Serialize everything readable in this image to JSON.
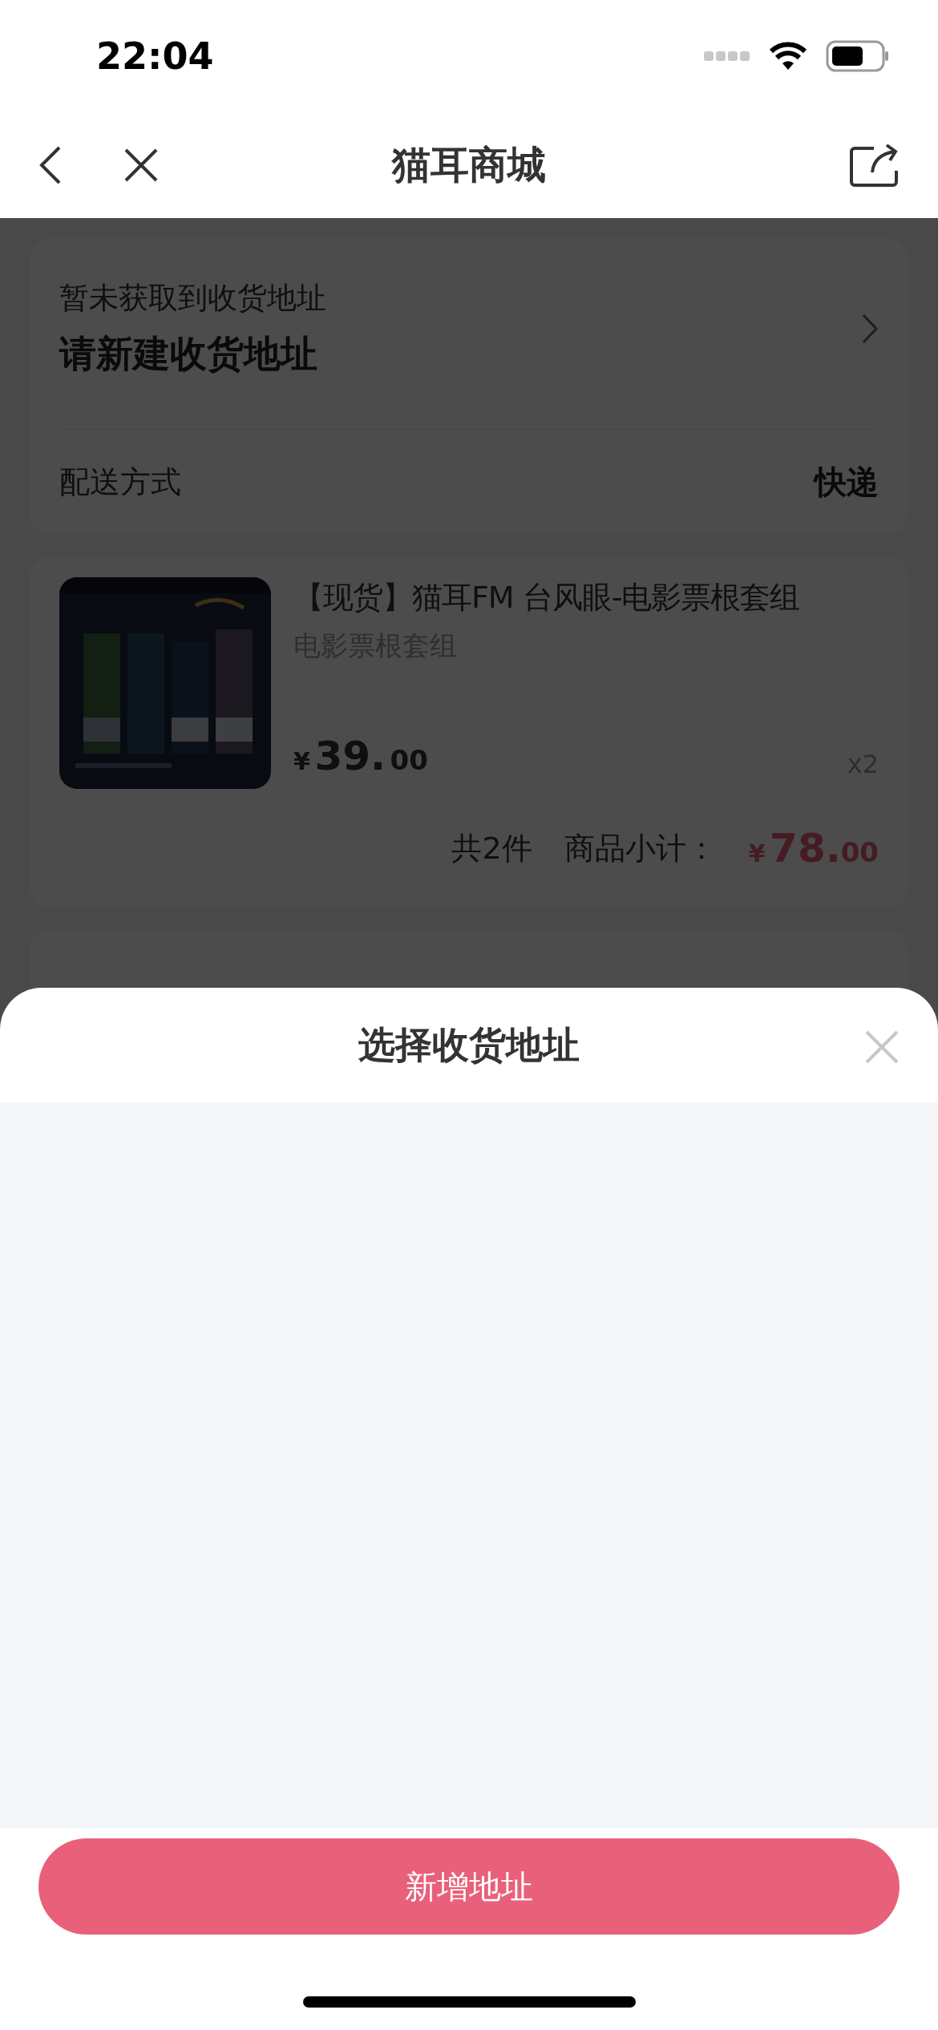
{
  "status_bar": {
    "time": "22:04"
  },
  "nav": {
    "title": "猫耳商城"
  },
  "address": {
    "hint": "暂未获取到收货地址",
    "prompt": "请新建收货地址"
  },
  "delivery": {
    "label": "配送方式",
    "value": "快递"
  },
  "order_item": {
    "title": "【现货】猫耳FM 台风眼-电影票根套组",
    "variant": "电影票根套组",
    "currency": "¥",
    "price_int": "39.",
    "price_dec": "00",
    "quantity": "x2"
  },
  "summary": {
    "count": "共2件",
    "label": "商品小计：",
    "currency": "¥",
    "total_int": "78.",
    "total_dec": "00"
  },
  "sheet": {
    "title": "选择收货地址",
    "button": "新增地址"
  }
}
